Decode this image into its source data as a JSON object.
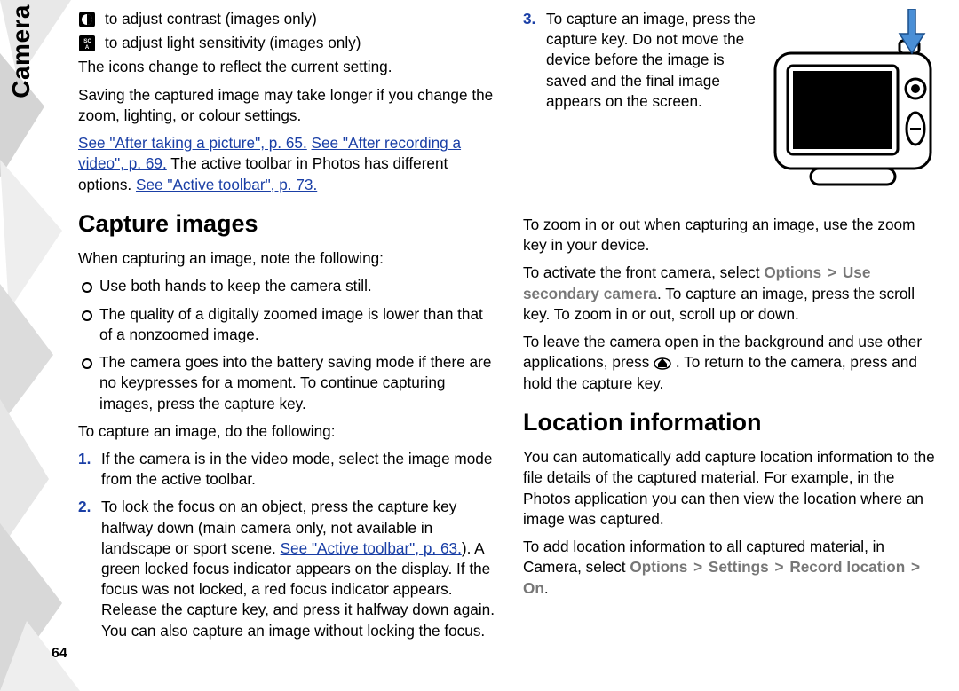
{
  "side_label": "Camera",
  "page_number": "64",
  "icon_lines": {
    "contrast": "to adjust contrast (images only)",
    "iso": "to adjust light sensitivity (images only)"
  },
  "p_icons_change": "The icons change to reflect the current setting.",
  "p_saving": "Saving the captured image may take longer if you change the zoom, lighting, or colour settings.",
  "link_after_pic": "See \"After taking a picture\", p. 65.",
  "link_after_vid": "See \"After recording a video\", p. 69.",
  "p_toolbar_mid": " The active toolbar in Photos has different options. ",
  "link_active_toolbar": "See \"Active toolbar\", p. 73.",
  "h_capture": "Capture images",
  "p_when_capturing": "When capturing an image, note the following:",
  "bullets": [
    "Use both hands to keep the camera still.",
    "The quality of a digitally zoomed image is lower than that of a nonzoomed image.",
    "The camera goes into the battery saving mode if there are no keypresses for a moment. To continue capturing images, press the capture key."
  ],
  "p_to_capture": "To capture an image, do the following:",
  "step1": "If the camera is in the video mode, select the image mode from the active toolbar.",
  "step2_a": "To lock the focus on an object, press the capture key halfway down (main camera only, not available in landscape or sport scene. ",
  "step2_link": "See \"Active toolbar\", p. 63.",
  "step2_b": "). A green locked focus indicator appears on the display. If the focus was not locked, a red focus indicator appears. Release the capture key, and press it halfway down again. You can also capture an image without locking the focus.",
  "step3": "To capture an image, press the capture key. Do not move the device before the image is saved and the final image appears on the screen.",
  "p_zoom": "To zoom in or out when capturing an image, use the zoom key in your device.",
  "p_front_a": "To activate the front camera, select ",
  "ui_options": "Options",
  "ui_sep": ">",
  "ui_secondary": "Use secondary camera",
  "p_front_b": ". To capture an image, press the scroll key. To zoom in or out, scroll up or down.",
  "p_bg_a": "To leave the camera open in the background and use other applications, press ",
  "p_bg_b": " . To return to the camera, press and hold the capture key.",
  "h_location": "Location information",
  "p_loc1": "You can automatically add capture location information to the file details of the captured material. For example, in the Photos application you can then view the location where an image was captured.",
  "p_loc2_a": "To add location information to all captured material, in Camera, select ",
  "ui_settings": "Settings",
  "ui_record": "Record location",
  "ui_on": "On",
  "p_loc2_b": "."
}
